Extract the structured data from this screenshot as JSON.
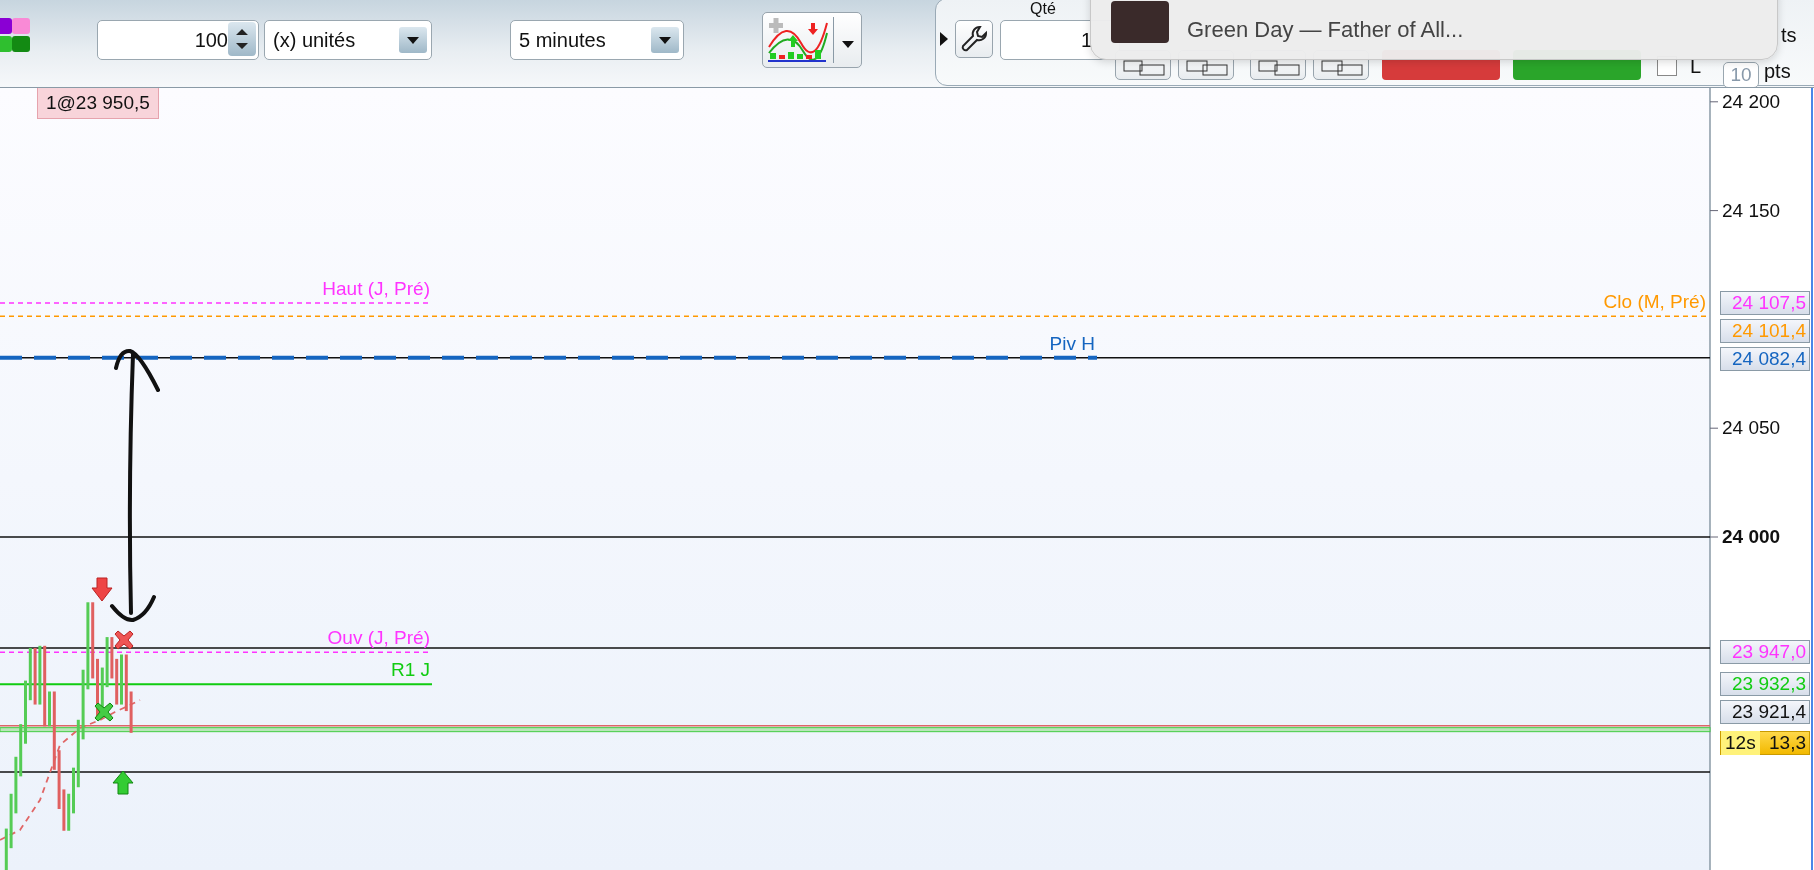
{
  "toolbar": {
    "quantity": "100",
    "unit": "(x) unités",
    "timeframe": "5 minutes",
    "qty_label": "Qté",
    "qty_value": "1",
    "top_unit": "ts",
    "checkbox": {
      "label": "L",
      "checked": false
    },
    "distance": "10",
    "distance_unit": "pts"
  },
  "notification": {
    "title": "Green Day — Father of All..."
  },
  "chart": {
    "order_tag": "1@23 950,5",
    "y_ticks": [
      {
        "label": "24 200",
        "bold": false
      },
      {
        "label": "24 150",
        "bold": false
      },
      {
        "label": "24 050",
        "bold": false
      },
      {
        "label": "24 000",
        "bold": true
      }
    ],
    "levels": [
      {
        "label": "Haut (J, Pré)",
        "tag": "24 107,5",
        "color": "#ff33ff",
        "kind": "session"
      },
      {
        "label": "Clo (M, Pré)",
        "tag": "24 101,4",
        "color": "#ff9900",
        "kind": "period"
      },
      {
        "label": "Piv H",
        "tag": "24 082,4",
        "color": "#1565c0",
        "kind": "pivot"
      },
      {
        "label": "Ouv (J, Pré)",
        "tag": "23 947,0",
        "color": "#ff33ff",
        "kind": "session"
      },
      {
        "label": "R1 J",
        "tag": "23 932,3",
        "color": "#11cc11",
        "kind": "resistance"
      }
    ],
    "last_tag": "23 921,4",
    "countdown": {
      "timer": "12s",
      "price": "13,3"
    }
  }
}
